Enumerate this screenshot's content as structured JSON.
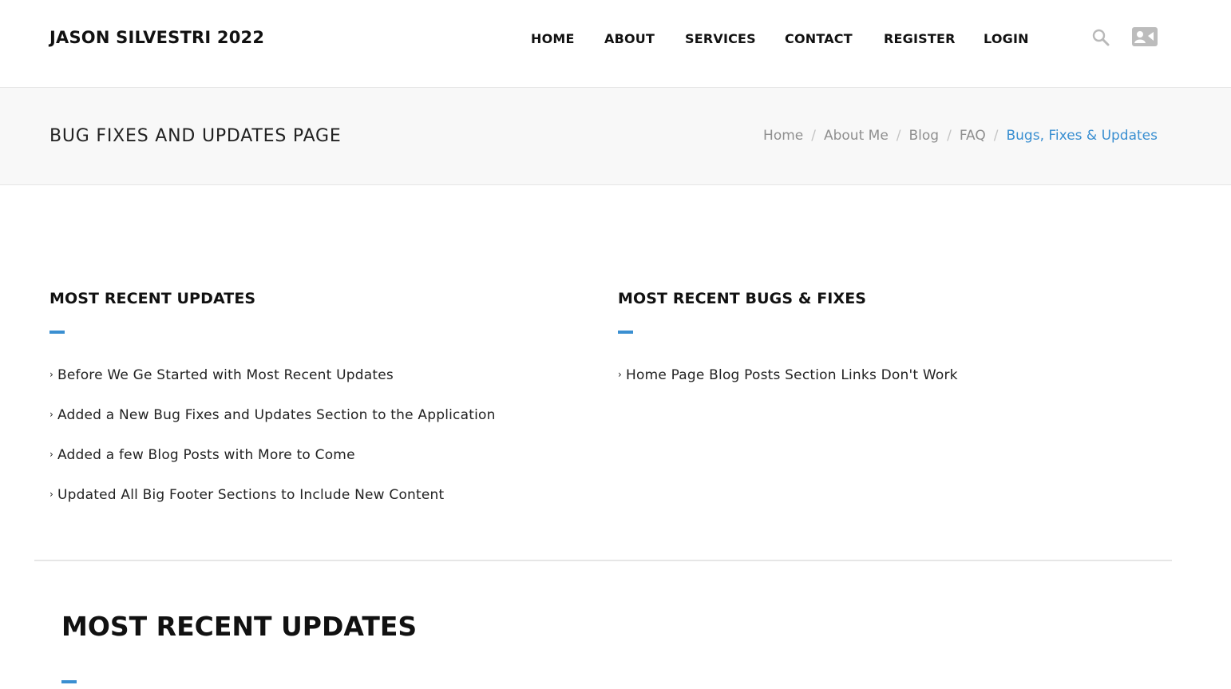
{
  "header": {
    "brand": "JASON SILVESTRI 2022",
    "nav": [
      "HOME",
      "ABOUT",
      "SERVICES",
      "CONTACT",
      "REGISTER",
      "LOGIN"
    ],
    "icons": [
      "search-icon",
      "contact-card-icon"
    ]
  },
  "titlebar": {
    "title": "BUG FIXES AND UPDATES PAGE",
    "breadcrumbs": [
      "Home",
      "About Me",
      "Blog",
      "FAQ"
    ],
    "current": "Bugs, Fixes & Updates"
  },
  "updates": {
    "heading": "MOST RECENT UPDATES",
    "items": [
      "Before We Ge Started with Most Recent Updates",
      "Added a New Bug Fixes and Updates Section to the Application",
      "Added a few Blog Posts with More to Come",
      "Updated All Big Footer Sections to Include New Content"
    ]
  },
  "bugs": {
    "heading": "MOST RECENT BUGS & FIXES",
    "items": [
      "Home Page Blog Posts Section Links Don't Work"
    ]
  },
  "section2": {
    "heading": "MOST RECENT UPDATES"
  },
  "colors": {
    "accent": "#3a8fd1",
    "text": "#111111",
    "muted": "#8f8f8f",
    "band": "#f8f8f8"
  }
}
